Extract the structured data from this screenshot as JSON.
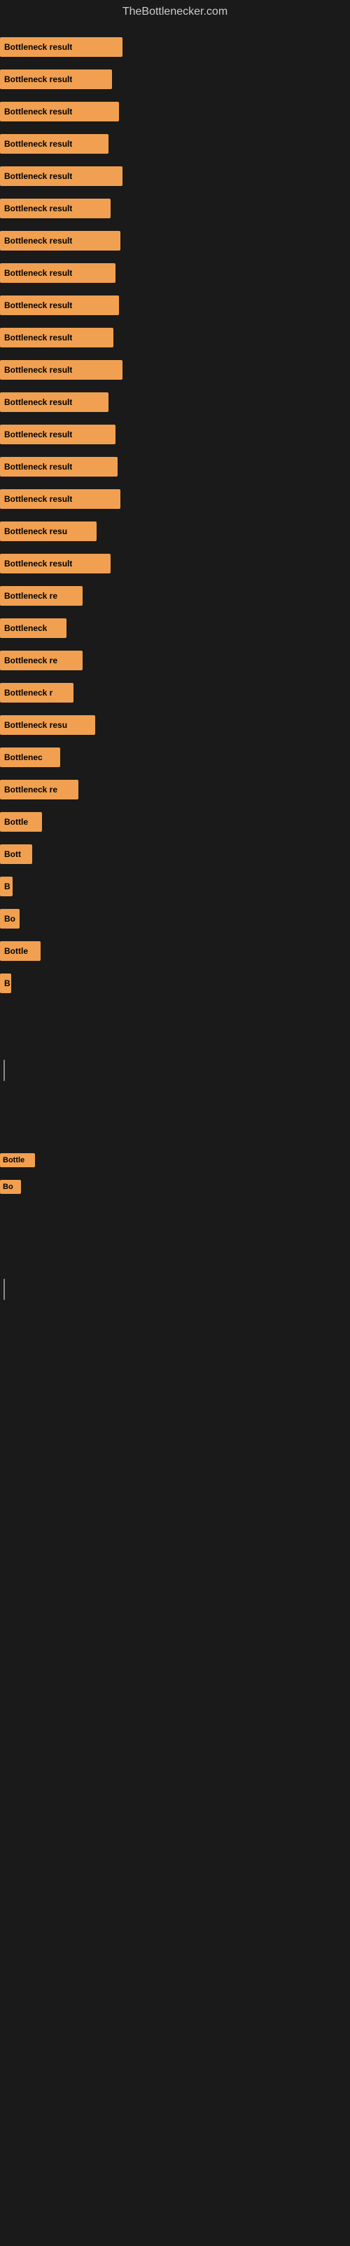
{
  "site": {
    "title": "TheBottlenecker.com"
  },
  "bars": [
    {
      "label": "Bottleneck result",
      "width": 175,
      "row": 1
    },
    {
      "label": "Bottleneck result",
      "width": 160,
      "row": 2
    },
    {
      "label": "Bottleneck result",
      "width": 170,
      "row": 3
    },
    {
      "label": "Bottleneck result",
      "width": 155,
      "row": 4
    },
    {
      "label": "Bottleneck result",
      "width": 175,
      "row": 5
    },
    {
      "label": "Bottleneck result",
      "width": 158,
      "row": 6
    },
    {
      "label": "Bottleneck result",
      "width": 172,
      "row": 7
    },
    {
      "label": "Bottleneck result",
      "width": 165,
      "row": 8
    },
    {
      "label": "Bottleneck result",
      "width": 170,
      "row": 9
    },
    {
      "label": "Bottleneck result",
      "width": 162,
      "row": 10
    },
    {
      "label": "Bottleneck result",
      "width": 175,
      "row": 11
    },
    {
      "label": "Bottleneck result",
      "width": 158,
      "row": 12
    },
    {
      "label": "Bottleneck result",
      "width": 165,
      "row": 13
    },
    {
      "label": "Bottleneck result",
      "width": 168,
      "row": 14
    },
    {
      "label": "Bottleneck result",
      "width": 172,
      "row": 15
    },
    {
      "label": "Bottleneck resu",
      "width": 140,
      "row": 16
    },
    {
      "label": "Bottleneck result",
      "width": 158,
      "row": 17
    },
    {
      "label": "Bottleneck re",
      "width": 120,
      "row": 18
    },
    {
      "label": "Bottleneck",
      "width": 95,
      "row": 19
    },
    {
      "label": "Bottleneck re",
      "width": 118,
      "row": 20
    },
    {
      "label": "Bottleneck r",
      "width": 108,
      "row": 21
    },
    {
      "label": "Bottleneck resu",
      "width": 138,
      "row": 22
    },
    {
      "label": "Bottlenec",
      "width": 88,
      "row": 23
    },
    {
      "label": "Bottleneck re",
      "width": 115,
      "row": 24
    },
    {
      "label": "Bottle",
      "width": 62,
      "row": 25
    },
    {
      "label": "Bott",
      "width": 48,
      "row": 26
    },
    {
      "label": "B",
      "width": 20,
      "row": 27
    },
    {
      "label": "Bo",
      "width": 30,
      "row": 28
    },
    {
      "label": "Bottle",
      "width": 60,
      "row": 29
    },
    {
      "label": "B",
      "width": 18,
      "row": 30
    }
  ],
  "cursor": {
    "visible": true
  }
}
